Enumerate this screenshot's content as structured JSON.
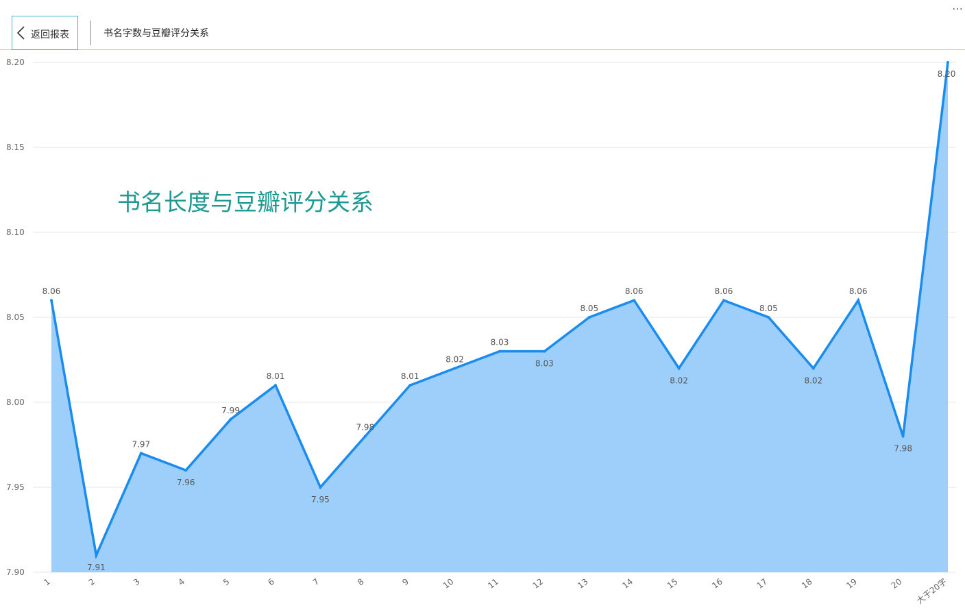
{
  "header": {
    "back_label": "返回报表",
    "page_title": "书名字数与豆瓣评分关系",
    "more_icon": "…"
  },
  "colors": {
    "line": "#1a8cf0",
    "area": "#9ecffa",
    "title": "#1f9a93",
    "grid": "#e6e6e6",
    "header_border": "#d8c7a8",
    "back_button_border": "#41b6c9"
  },
  "chart_data": {
    "type": "area",
    "title": "书名长度与豆瓣评分关系",
    "xlabel": "",
    "ylabel": "",
    "categories": [
      "1",
      "2",
      "3",
      "4",
      "5",
      "6",
      "7",
      "8",
      "9",
      "10",
      "11",
      "12",
      "13",
      "14",
      "15",
      "16",
      "17",
      "18",
      "19",
      "20",
      "大于20字"
    ],
    "values": [
      8.06,
      7.91,
      7.97,
      7.96,
      7.99,
      8.01,
      7.95,
      7.98,
      8.01,
      8.02,
      8.03,
      8.03,
      8.05,
      8.06,
      8.02,
      8.06,
      8.05,
      8.02,
      8.06,
      7.98,
      8.2
    ],
    "label_position": [
      "above",
      "below",
      "above",
      "below",
      "above",
      "above",
      "below",
      "above",
      "above",
      "above",
      "above",
      "below",
      "above",
      "above",
      "below",
      "above",
      "above",
      "below",
      "above",
      "below",
      "below"
    ],
    "ylim": [
      7.9,
      8.2
    ],
    "yticks": [
      "7.90",
      "7.95",
      "8.00",
      "8.05",
      "8.10",
      "8.15",
      "8.20"
    ],
    "grid": true,
    "legend": "none"
  }
}
